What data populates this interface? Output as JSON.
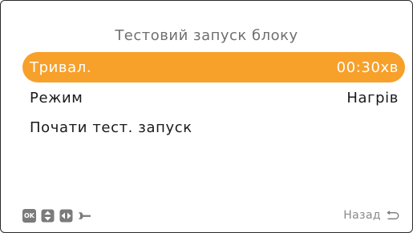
{
  "screen": {
    "title": "Тестовий запуск блоку"
  },
  "menu": {
    "items": [
      {
        "label": "Тривал.",
        "value": "00:30хв",
        "selected": true
      },
      {
        "label": "Режим",
        "value": "Нагрів",
        "selected": false
      },
      {
        "label": "Почати тест. запуск",
        "value": "",
        "selected": false
      }
    ]
  },
  "footer": {
    "ok_label": "OK",
    "icons": [
      "ok-icon",
      "up-down-arrows-icon",
      "left-right-arrows-icon",
      "wrench-icon"
    ],
    "back_label": "Назад",
    "back_icon": "return-arrow-icon"
  },
  "colors": {
    "accent": "#f7a02a",
    "title_text": "#707070",
    "body_text": "#1a1a1a",
    "hint_text": "#8a8a8a"
  }
}
